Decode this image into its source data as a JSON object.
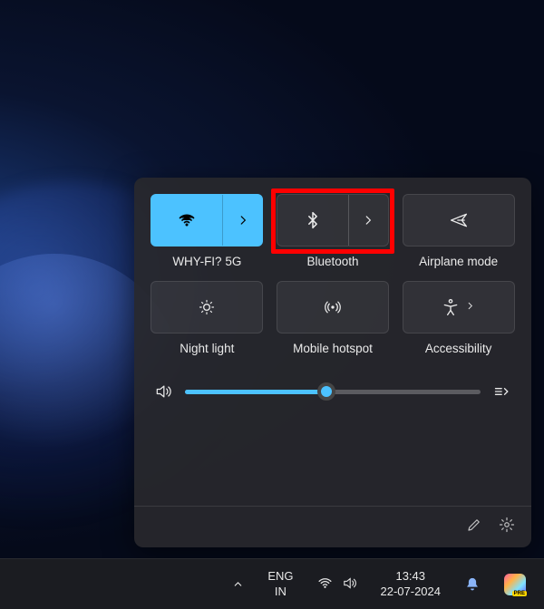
{
  "panel": {
    "tiles": [
      {
        "label": "WHY-FI? 5G"
      },
      {
        "label": "Bluetooth"
      },
      {
        "label": "Airplane mode"
      },
      {
        "label": "Night light"
      },
      {
        "label": "Mobile hotspot"
      },
      {
        "label": "Accessibility"
      }
    ],
    "volume_percent": 48
  },
  "taskbar": {
    "lang1": "ENG",
    "lang2": "IN",
    "time": "13:43",
    "date": "22-07-2024",
    "copilot_badge": "PRE"
  }
}
